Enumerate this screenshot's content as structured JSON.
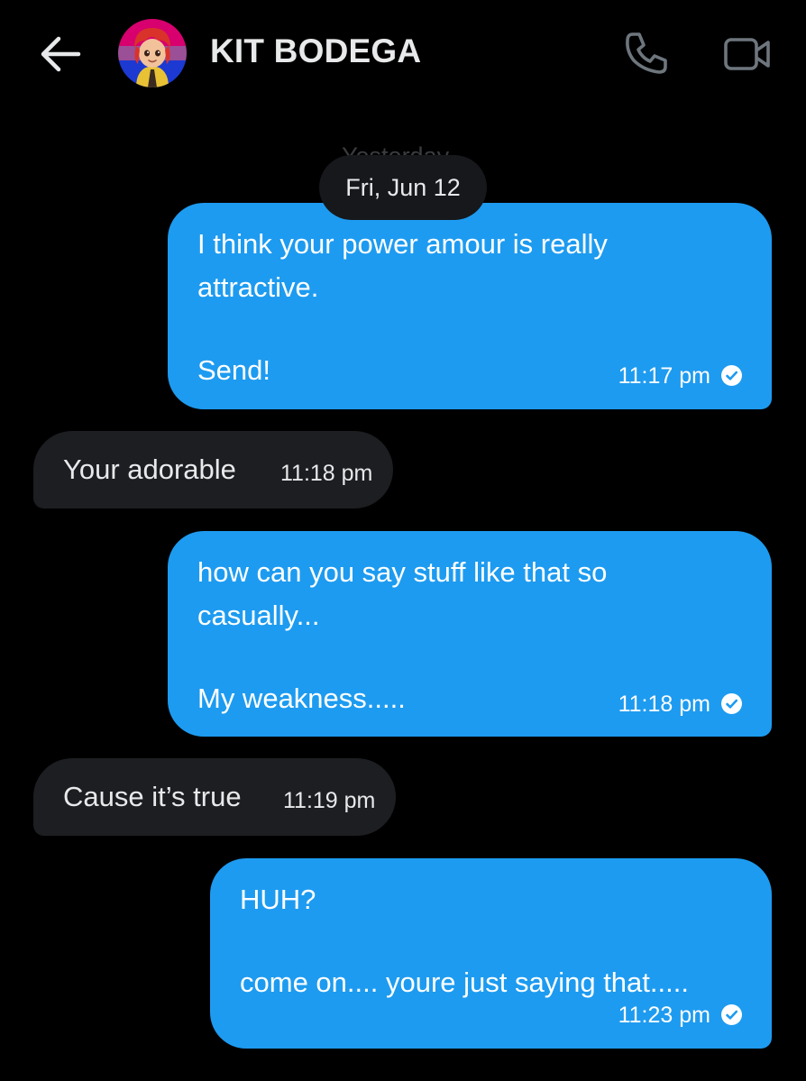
{
  "header": {
    "contact_name": "KIT BODEGA",
    "icons": {
      "back": "arrow-left-icon",
      "avatar": "contact-avatar",
      "call": "phone-icon",
      "video": "video-camera-icon"
    }
  },
  "date_separator": {
    "stale_label": "Yesterday",
    "label": "Fri, Jun 12"
  },
  "colors": {
    "background": "#000000",
    "outgoing_bubble": "#1d9bf0",
    "incoming_bubble": "#1c1e21",
    "text_primary": "#e7e9ea"
  },
  "messages": [
    {
      "direction": "outgoing",
      "lines": [
        "I think your power amour is really",
        "attractive.",
        "",
        "Send!"
      ],
      "time": "11:17 pm",
      "status": "read"
    },
    {
      "direction": "incoming",
      "lines": [
        "Your adorable"
      ],
      "time": "11:18 pm"
    },
    {
      "direction": "outgoing",
      "lines": [
        "how can you say stuff like that so",
        "casually...",
        "",
        "My weakness....."
      ],
      "time": "11:18 pm",
      "status": "read"
    },
    {
      "direction": "incoming",
      "lines": [
        "Cause it’s true"
      ],
      "time": "11:19 pm"
    },
    {
      "direction": "outgoing",
      "lines": [
        "HUH?",
        "",
        "come on.... youre just saying that....."
      ],
      "time": "11:23 pm",
      "status": "read"
    }
  ]
}
